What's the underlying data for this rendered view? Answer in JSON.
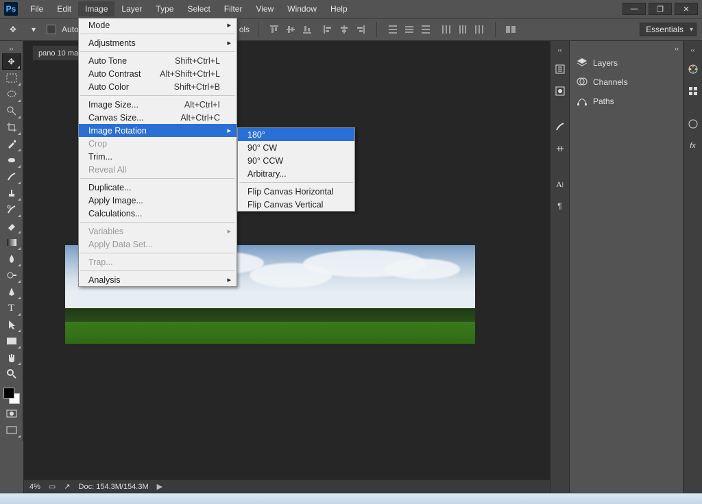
{
  "menubar": {
    "items": [
      "File",
      "Edit",
      "Image",
      "Layer",
      "Type",
      "Select",
      "Filter",
      "View",
      "Window",
      "Help"
    ],
    "active_index": 2
  },
  "optionsbar": {
    "auto_label": "Auto-",
    "controls_tail": "ols",
    "workspace": "Essentials"
  },
  "document": {
    "tab_title": "pano 10 ma",
    "zoom": "4%",
    "doc_size": "Doc: 154.3M/154.3M"
  },
  "panels": {
    "rows": [
      {
        "icon": "layers-icon",
        "label": "Layers"
      },
      {
        "icon": "channels-icon",
        "label": "Channels"
      },
      {
        "icon": "paths-icon",
        "label": "Paths"
      }
    ]
  },
  "image_menu": {
    "groups": [
      [
        {
          "label": "Mode",
          "submenu": true
        }
      ],
      [
        {
          "label": "Adjustments",
          "submenu": true
        }
      ],
      [
        {
          "label": "Auto Tone",
          "shortcut": "Shift+Ctrl+L"
        },
        {
          "label": "Auto Contrast",
          "shortcut": "Alt+Shift+Ctrl+L"
        },
        {
          "label": "Auto Color",
          "shortcut": "Shift+Ctrl+B"
        }
      ],
      [
        {
          "label": "Image Size...",
          "shortcut": "Alt+Ctrl+I"
        },
        {
          "label": "Canvas Size...",
          "shortcut": "Alt+Ctrl+C"
        },
        {
          "label": "Image Rotation",
          "submenu": true,
          "highlight": true
        },
        {
          "label": "Crop",
          "disabled": true
        },
        {
          "label": "Trim..."
        },
        {
          "label": "Reveal All",
          "disabled": true
        }
      ],
      [
        {
          "label": "Duplicate..."
        },
        {
          "label": "Apply Image..."
        },
        {
          "label": "Calculations..."
        }
      ],
      [
        {
          "label": "Variables",
          "submenu": true,
          "disabled": true
        },
        {
          "label": "Apply Data Set...",
          "disabled": true
        }
      ],
      [
        {
          "label": "Trap...",
          "disabled": true
        }
      ],
      [
        {
          "label": "Analysis",
          "submenu": true
        }
      ]
    ]
  },
  "rotation_submenu": {
    "groups": [
      [
        {
          "label": "180°",
          "highlight": true
        },
        {
          "label": "90° CW"
        },
        {
          "label": "90° CCW"
        },
        {
          "label": "Arbitrary..."
        }
      ],
      [
        {
          "label": "Flip Canvas Horizontal"
        },
        {
          "label": "Flip Canvas Vertical"
        }
      ]
    ]
  }
}
